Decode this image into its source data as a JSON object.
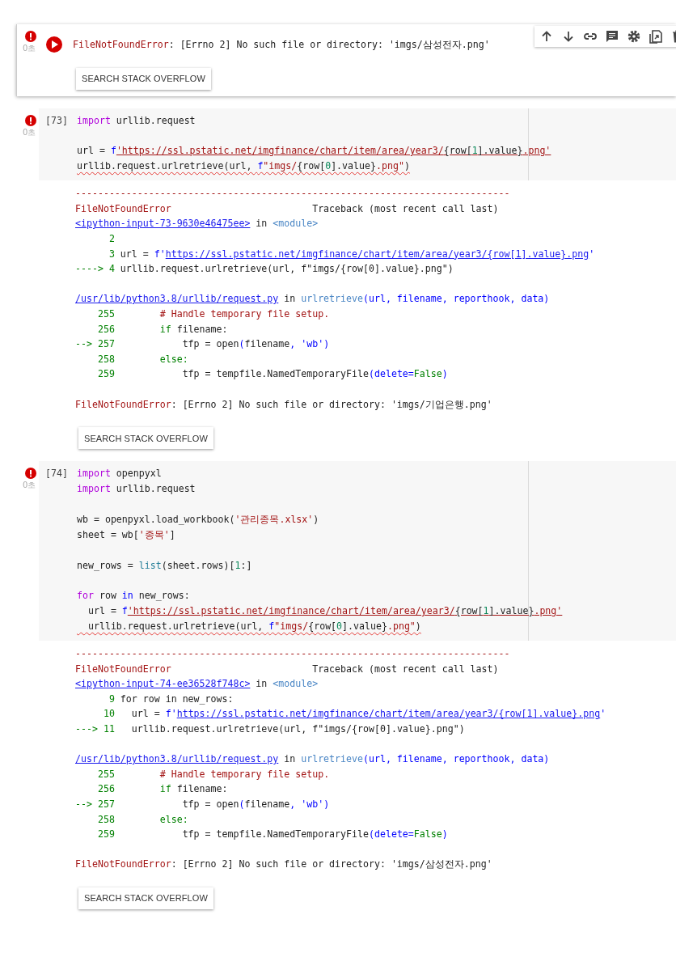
{
  "cells": [
    {
      "kind": "output",
      "active": true,
      "error": true,
      "time": "0초",
      "output": {
        "error": [
          {
            "kind": "err",
            "text": "FileNotFoundError"
          },
          {
            "kind": "plain",
            "text": ": [Errno 2] No such file or directory: 'imgs/삼성전자.png'"
          }
        ],
        "button": "SEARCH STACK OVERFLOW"
      }
    },
    {
      "kind": "code",
      "active": false,
      "error": true,
      "time": "0초",
      "count": "[73]",
      "code": [
        {
          "gap": false,
          "squiggle": false,
          "tokens": [
            {
              "kind": "kw",
              "text": "import"
            },
            {
              "kind": "plain",
              "text": " urllib.request"
            }
          ]
        },
        {
          "gap": true,
          "squiggle": false,
          "tokens": [
            {
              "kind": "plain",
              "text": "url = "
            },
            {
              "kind": "blue",
              "text": "f"
            },
            {
              "kind": "str_u",
              "text": "'https://ssl.pstatic.net/imgfinance/chart/item/area/year3/"
            },
            {
              "kind": "plain_u",
              "text": "{row["
            },
            {
              "kind": "num_u",
              "text": "1"
            },
            {
              "kind": "plain_u",
              "text": "].value}"
            },
            {
              "kind": "str_u",
              "text": ".png'"
            }
          ]
        },
        {
          "gap": false,
          "squiggle": true,
          "tokens": [
            {
              "kind": "plain",
              "text": "urllib.request.urlretrieve(url, "
            },
            {
              "kind": "blue",
              "text": "f"
            },
            {
              "kind": "str",
              "text": "\"imgs/"
            },
            {
              "kind": "plain",
              "text": "{row["
            },
            {
              "kind": "num",
              "text": "0"
            },
            {
              "kind": "plain",
              "text": "].value}"
            },
            {
              "kind": "str",
              "text": ".png\""
            },
            {
              "kind": "plain",
              "text": ")"
            }
          ]
        }
      ],
      "output": {
        "traceback": {
          "rule": "-----------------------------------------------------------------------------",
          "name": "FileNotFoundError",
          "title": "Traceback (most recent call last)",
          "frames": [
            {
              "location": [
                {
                  "kind": "link",
                  "text": "<ipython-input-73-9630e46475ee>"
                },
                {
                  "kind": "plain",
                  "text": " in "
                },
                {
                  "kind": "cls",
                  "text": "<module>"
                }
              ],
              "lines": [
                [
                  {
                    "kind": "tnum",
                    "text": "      2"
                  }
                ],
                [
                  {
                    "kind": "tnum",
                    "text": "      3"
                  },
                  {
                    "kind": "plain",
                    "text": " url = "
                  },
                  {
                    "kind": "blue",
                    "text": "f'"
                  },
                  {
                    "kind": "link",
                    "text": "https://ssl.pstatic.net/imgfinance/chart/item/area/year3/{row[1].value}.png"
                  },
                  {
                    "kind": "blue",
                    "text": "'"
                  }
                ],
                [
                  {
                    "kind": "tnum",
                    "text": "----> 4"
                  },
                  {
                    "kind": "plain",
                    "text": " urllib.request.urlretrieve(url, f\"imgs/{row[0].value}.png\")"
                  }
                ]
              ]
            },
            {
              "location": [
                {
                  "kind": "link",
                  "text": "/usr/lib/python3.8/urllib/request.py"
                },
                {
                  "kind": "plain",
                  "text": " in "
                },
                {
                  "kind": "cls",
                  "text": "urlretrieve"
                },
                {
                  "kind": "blue",
                  "text": "(url, filename, reporthook, data)"
                }
              ],
              "lines": [
                [
                  {
                    "kind": "tnum",
                    "text": "    255"
                  },
                  {
                    "kind": "err",
                    "text": "        # Handle temporary file setup."
                  }
                ],
                [
                  {
                    "kind": "tnum",
                    "text": "    256"
                  },
                  {
                    "kind": "tnum",
                    "text": "        if"
                  },
                  {
                    "kind": "plain",
                    "text": " filename:"
                  }
                ],
                [
                  {
                    "kind": "tnum",
                    "text": "--> 257"
                  },
                  {
                    "kind": "plain",
                    "text": "            tfp = open"
                  },
                  {
                    "kind": "blue",
                    "text": "("
                  },
                  {
                    "kind": "plain",
                    "text": "filename"
                  },
                  {
                    "kind": "blue",
                    "text": ", 'wb')"
                  }
                ],
                [
                  {
                    "kind": "tnum",
                    "text": "    258"
                  },
                  {
                    "kind": "tnum",
                    "text": "        else:"
                  }
                ],
                [
                  {
                    "kind": "tnum",
                    "text": "    259"
                  },
                  {
                    "kind": "plain",
                    "text": "            tfp = tempfile.NamedTemporaryFile"
                  },
                  {
                    "kind": "blue",
                    "text": "(delete="
                  },
                  {
                    "kind": "tnum",
                    "text": "False"
                  },
                  {
                    "kind": "blue",
                    "text": ")"
                  }
                ]
              ]
            }
          ]
        },
        "error": [
          {
            "kind": "err",
            "text": "FileNotFoundError"
          },
          {
            "kind": "plain",
            "text": ": [Errno 2] No such file or directory: 'imgs/기업은행.png'"
          }
        ],
        "button": "SEARCH STACK OVERFLOW"
      }
    },
    {
      "kind": "code",
      "active": false,
      "error": true,
      "time": "0초",
      "count": "[74]",
      "code": [
        {
          "gap": false,
          "squiggle": false,
          "tokens": [
            {
              "kind": "kw",
              "text": "import"
            },
            {
              "kind": "plain",
              "text": " openpyxl"
            }
          ]
        },
        {
          "gap": false,
          "squiggle": false,
          "tokens": [
            {
              "kind": "kw",
              "text": "import"
            },
            {
              "kind": "plain",
              "text": " urllib.request"
            }
          ]
        },
        {
          "gap": true,
          "squiggle": false,
          "tokens": [
            {
              "kind": "plain",
              "text": "wb = openpyxl.load_workbook("
            },
            {
              "kind": "str",
              "text": "'관리종목.xlsx'"
            },
            {
              "kind": "plain",
              "text": ")"
            }
          ]
        },
        {
          "gap": false,
          "squiggle": false,
          "tokens": [
            {
              "kind": "plain",
              "text": "sheet = wb["
            },
            {
              "kind": "str",
              "text": "'종목'"
            },
            {
              "kind": "plain",
              "text": "]"
            }
          ]
        },
        {
          "gap": true,
          "squiggle": false,
          "tokens": [
            {
              "kind": "plain",
              "text": "new_rows = "
            },
            {
              "kind": "builtin",
              "text": "list"
            },
            {
              "kind": "plain",
              "text": "(sheet.rows)["
            },
            {
              "kind": "num",
              "text": "1"
            },
            {
              "kind": "plain",
              "text": ":]"
            }
          ]
        },
        {
          "gap": true,
          "squiggle": false,
          "tokens": [
            {
              "kind": "kw",
              "text": "for"
            },
            {
              "kind": "plain",
              "text": " row "
            },
            {
              "kind": "blue",
              "text": "in"
            },
            {
              "kind": "plain",
              "text": " new_rows:"
            }
          ]
        },
        {
          "gap": false,
          "squiggle": false,
          "tokens": [
            {
              "kind": "plain",
              "text": "  url = "
            },
            {
              "kind": "blue",
              "text": "f"
            },
            {
              "kind": "str_u",
              "text": "'https://ssl.pstatic.net/imgfinance/chart/item/area/year3/"
            },
            {
              "kind": "plain_u",
              "text": "{row["
            },
            {
              "kind": "num_u",
              "text": "1"
            },
            {
              "kind": "plain_u",
              "text": "].value}"
            },
            {
              "kind": "str_u",
              "text": ".png'"
            }
          ]
        },
        {
          "gap": false,
          "squiggle": true,
          "tokens": [
            {
              "kind": "plain",
              "text": "  urllib.request.urlretrieve(url, "
            },
            {
              "kind": "blue",
              "text": "f"
            },
            {
              "kind": "str",
              "text": "\"imgs/"
            },
            {
              "kind": "plain",
              "text": "{row["
            },
            {
              "kind": "num",
              "text": "0"
            },
            {
              "kind": "plain",
              "text": "].value}"
            },
            {
              "kind": "str",
              "text": ".png\""
            },
            {
              "kind": "plain",
              "text": ")"
            }
          ]
        }
      ],
      "output": {
        "traceback": {
          "rule": "-----------------------------------------------------------------------------",
          "name": "FileNotFoundError",
          "title": "Traceback (most recent call last)",
          "frames": [
            {
              "location": [
                {
                  "kind": "link",
                  "text": "<ipython-input-74-ee36528f748c>"
                },
                {
                  "kind": "plain",
                  "text": " in "
                },
                {
                  "kind": "cls",
                  "text": "<module>"
                }
              ],
              "lines": [
                [
                  {
                    "kind": "tnum",
                    "text": "      9"
                  },
                  {
                    "kind": "plain",
                    "text": " for row in new_rows:"
                  }
                ],
                [
                  {
                    "kind": "tnum",
                    "text": "     10"
                  },
                  {
                    "kind": "plain",
                    "text": "   url = "
                  },
                  {
                    "kind": "blue",
                    "text": "f'"
                  },
                  {
                    "kind": "link",
                    "text": "https://ssl.pstatic.net/imgfinance/chart/item/area/year3/{row[1].value}.png"
                  },
                  {
                    "kind": "blue",
                    "text": "'"
                  }
                ],
                [
                  {
                    "kind": "tnum",
                    "text": "---> 11"
                  },
                  {
                    "kind": "plain",
                    "text": "   urllib.request.urlretrieve(url, f\"imgs/{row[0].value}.png\")"
                  }
                ]
              ]
            },
            {
              "location": [
                {
                  "kind": "link",
                  "text": "/usr/lib/python3.8/urllib/request.py"
                },
                {
                  "kind": "plain",
                  "text": " in "
                },
                {
                  "kind": "cls",
                  "text": "urlretrieve"
                },
                {
                  "kind": "blue",
                  "text": "(url, filename, reporthook, data)"
                }
              ],
              "lines": [
                [
                  {
                    "kind": "tnum",
                    "text": "    255"
                  },
                  {
                    "kind": "err",
                    "text": "        # Handle temporary file setup."
                  }
                ],
                [
                  {
                    "kind": "tnum",
                    "text": "    256"
                  },
                  {
                    "kind": "tnum",
                    "text": "        if"
                  },
                  {
                    "kind": "plain",
                    "text": " filename:"
                  }
                ],
                [
                  {
                    "kind": "tnum",
                    "text": "--> 257"
                  },
                  {
                    "kind": "plain",
                    "text": "            tfp = open"
                  },
                  {
                    "kind": "blue",
                    "text": "("
                  },
                  {
                    "kind": "plain",
                    "text": "filename"
                  },
                  {
                    "kind": "blue",
                    "text": ", 'wb')"
                  }
                ],
                [
                  {
                    "kind": "tnum",
                    "text": "    258"
                  },
                  {
                    "kind": "tnum",
                    "text": "        else:"
                  }
                ],
                [
                  {
                    "kind": "tnum",
                    "text": "    259"
                  },
                  {
                    "kind": "plain",
                    "text": "            tfp = tempfile.NamedTemporaryFile"
                  },
                  {
                    "kind": "blue",
                    "text": "(delete="
                  },
                  {
                    "kind": "tnum",
                    "text": "False"
                  },
                  {
                    "kind": "blue",
                    "text": ")"
                  }
                ]
              ]
            }
          ]
        },
        "error": [
          {
            "kind": "err",
            "text": "FileNotFoundError"
          },
          {
            "kind": "plain",
            "text": ": [Errno 2] No such file or directory: 'imgs/삼성전자.png'"
          }
        ],
        "button": "SEARCH STACK OVERFLOW"
      }
    }
  ]
}
